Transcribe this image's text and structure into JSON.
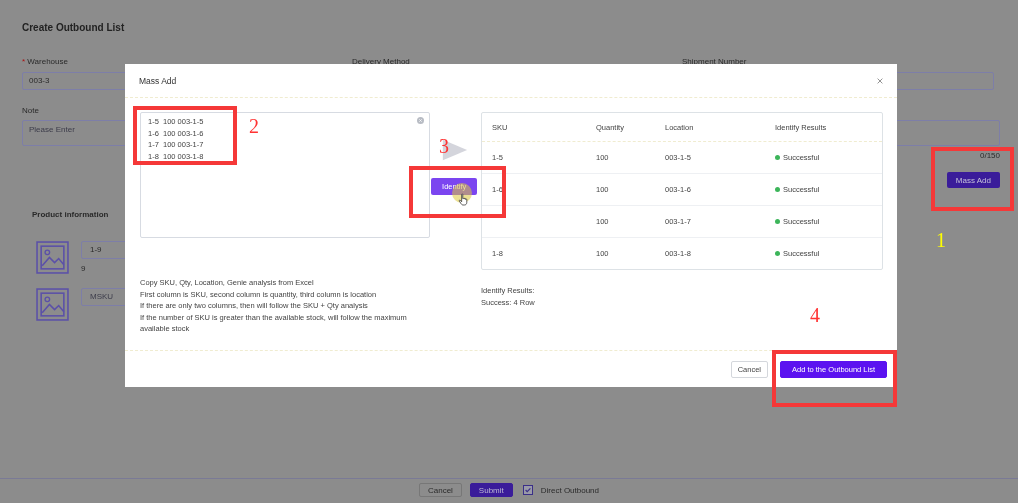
{
  "page": {
    "title": "Create Outbound List",
    "fields": [
      {
        "label": "Warehouse",
        "required_mark": "*",
        "value": "003-3"
      },
      {
        "label": "Delivery Method"
      },
      {
        "label": "Shipment Number"
      }
    ],
    "note": {
      "label": "Note",
      "placeholder": "Please Enter",
      "counter": "0/150"
    },
    "mass_add_button": "Mass Add",
    "product_section": {
      "title": "Product information",
      "products": [
        {
          "sku": "1-9",
          "quantity": "9"
        },
        {
          "sku_placeholder": "MSKU"
        }
      ]
    },
    "footer": {
      "cancel": "Cancel",
      "submit": "Submit",
      "direct_outbound": {
        "label": "Direct Outbound",
        "checked": true
      }
    }
  },
  "modal": {
    "title": "Mass Add",
    "input_lines": [
      "1-5  100 003-1-5",
      "1-6  100 003-1-6",
      "1-7  100 003-1-7",
      "1-8  100 003-1-8"
    ],
    "identify_button": "Identify",
    "table": {
      "columns": [
        "SKU",
        "Quantity",
        "Location",
        "Identify Results"
      ],
      "rows": [
        {
          "sku": "1-5",
          "quantity": "100",
          "location": "003-1-5",
          "result": "Successful",
          "color": "#3cb55a"
        },
        {
          "sku": "1-6",
          "quantity": "100",
          "location": "003-1-6",
          "result": "Successful",
          "color": "#3cb55a"
        },
        {
          "quantity": "100",
          "location": "003-1-7",
          "result": "Successful",
          "color": "#3cb55a"
        },
        {
          "sku": "1-8",
          "quantity": "100",
          "location": "003-1-8",
          "result": "Successful",
          "color": "#3cb55a"
        }
      ]
    },
    "help_lines": [
      "Copy SKU, Qty, Location, Genie analysis from Excel",
      "First column is SKU, second column is quantity, third column is location",
      "If there are only two columns, then will follow the SKU + Qty analysis",
      "If the number of SKU is greater than the available stock, will follow the maximum available stock"
    ],
    "summary": [
      "Identify Results:",
      "Success: 4 Row"
    ],
    "buttons": {
      "cancel": "Cancel",
      "confirm": "Add to the Outbound List"
    }
  },
  "annotations": [
    {
      "number": "1",
      "color": "#ffff00"
    },
    {
      "number": "2",
      "color": "#ff3333"
    },
    {
      "number": "3",
      "color": "#ff3333"
    },
    {
      "number": "4",
      "color": "#ff3333"
    }
  ]
}
